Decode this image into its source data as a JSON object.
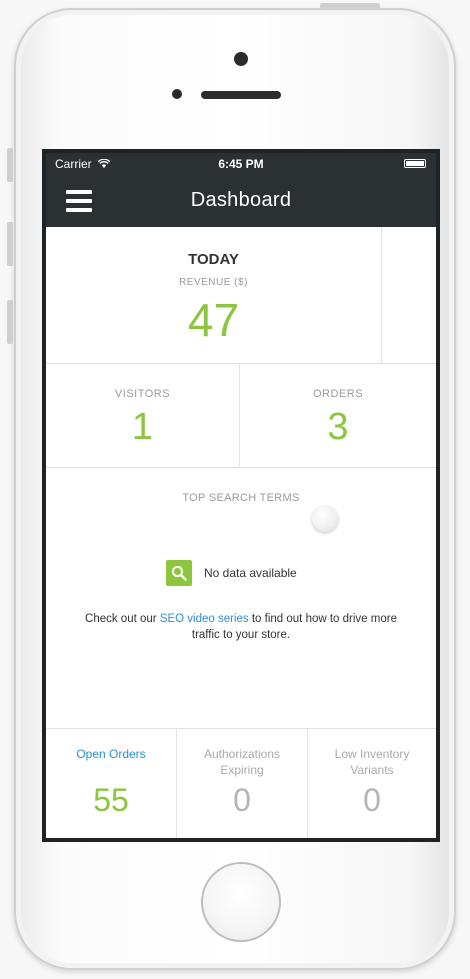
{
  "status_bar": {
    "carrier": "Carrier",
    "time": "6:45 PM"
  },
  "nav": {
    "title": "Dashboard"
  },
  "today": {
    "label": "TODAY",
    "revenue_label": "REVENUE ($)",
    "revenue_value": "47"
  },
  "visitors": {
    "label": "VISITORS",
    "value": "1"
  },
  "orders": {
    "label": "ORDERS",
    "value": "3"
  },
  "search_terms": {
    "title": "TOP SEARCH TERMS",
    "no_data": "No data available",
    "help_prefix": "Check out our ",
    "help_link": "SEO video series",
    "help_suffix": " to find out how to drive more traffic to your store."
  },
  "bottom_stats": [
    {
      "label": "Open Orders",
      "value": "55"
    },
    {
      "label": "Authorizations Expiring",
      "value": "0"
    },
    {
      "label": "Low Inventory Variants",
      "value": "0"
    }
  ],
  "colors": {
    "accent_green": "#8cc63f",
    "link_blue": "#2a8fd6",
    "bar_dark": "#2b3033"
  }
}
